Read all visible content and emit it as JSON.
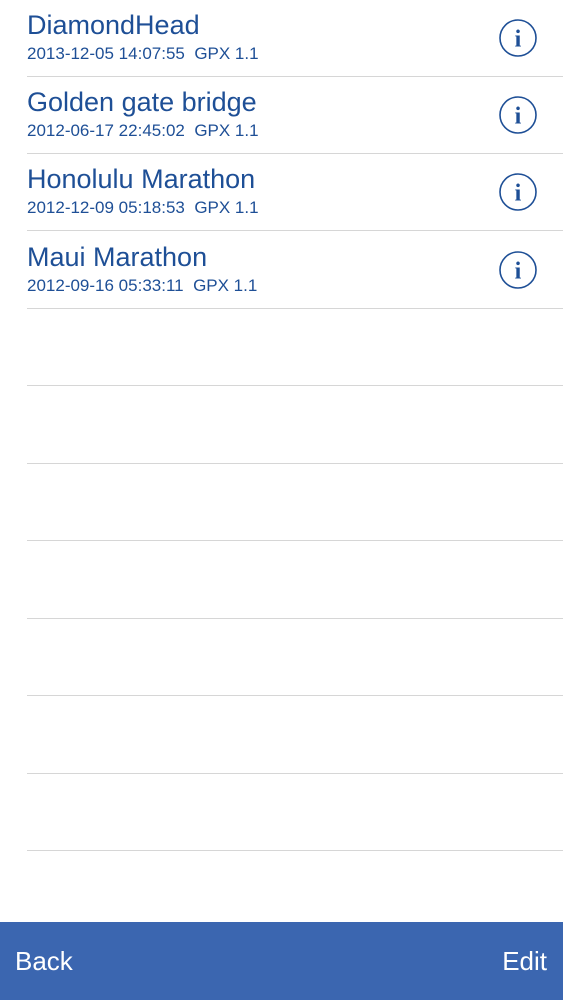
{
  "files": [
    {
      "name": "DiamondHead",
      "timestamp": "2013-12-05 14:07:55",
      "format": "GPX 1.1",
      "info_icon": "info-circle-icon"
    },
    {
      "name": "Golden gate bridge",
      "timestamp": "2012-06-17 22:45:02",
      "format": "GPX 1.1",
      "info_icon": "info-circle-icon"
    },
    {
      "name": "Honolulu Marathon",
      "timestamp": "2012-12-09 05:18:53",
      "format": "GPX 1.1",
      "info_icon": "info-circle-icon"
    },
    {
      "name": "Maui Marathon",
      "timestamp": "2012-09-16 05:33:11",
      "format": "GPX 1.1",
      "info_icon": "info-circle-icon"
    }
  ],
  "toolbar": {
    "back_label": "Back",
    "edit_label": "Edit"
  },
  "colors": {
    "text_accent": "#1e4f96",
    "toolbar_bg": "#3b66b0",
    "separator": "#d6d6d6",
    "toolbar_text": "#ffffff"
  }
}
